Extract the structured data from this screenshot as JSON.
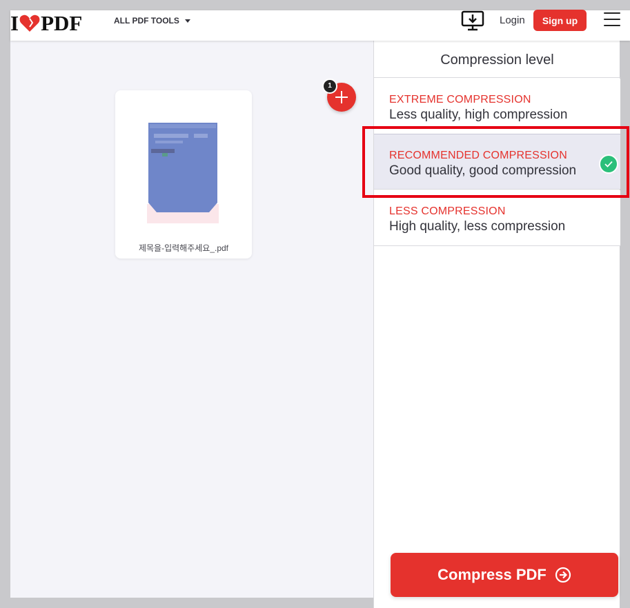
{
  "header": {
    "logo": {
      "left": "I",
      "right": "PDF",
      "heart_icon": "heart-icon"
    },
    "tools_menu_label": "ALL PDF TOOLS",
    "download_desktop_icon": "desktop-download-icon",
    "login_label": "Login",
    "signup_label": "Sign up",
    "menu_icon": "hamburger-menu-icon"
  },
  "workspace": {
    "file": {
      "name": "제목을-입력해주세요_.pdf"
    },
    "file_count": "1",
    "add_icon": "plus-icon"
  },
  "sidebar": {
    "title": "Compression level",
    "options": [
      {
        "title": "EXTREME COMPRESSION",
        "description": "Less quality, high compression",
        "selected": false
      },
      {
        "title": "RECOMMENDED COMPRESSION",
        "description": "Good quality, good compression",
        "selected": true
      },
      {
        "title": "LESS COMPRESSION",
        "description": "High quality, less compression",
        "selected": false
      }
    ]
  },
  "action": {
    "compress_label": "Compress PDF",
    "icon": "arrow-right-circle-icon"
  },
  "colors": {
    "brand": "#e5322d",
    "selected_bg": "#e9e9f2",
    "check": "#2bbf7a",
    "annotation": "#e60012"
  }
}
